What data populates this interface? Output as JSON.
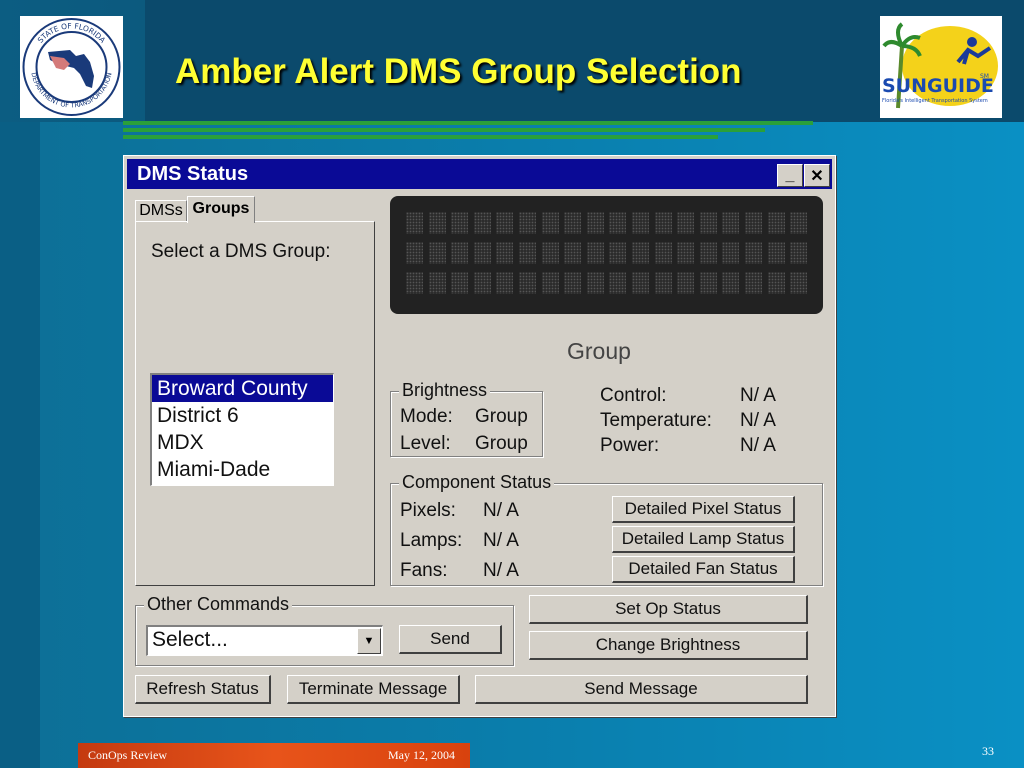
{
  "slide": {
    "title": "Amber Alert DMS Group Selection",
    "footer_left": "ConOps Review",
    "footer_date": "May 12, 2004",
    "page_number": "33",
    "logos": {
      "left": {
        "text_top": "STATE OF FLORIDA",
        "text_bottom": "DEPARTMENT OF TRANSPORTATION"
      },
      "right": {
        "wordmark": "SUNGUIDE",
        "tagline": "Florida's Intelligent Transportation System",
        "mark": "SM"
      }
    }
  },
  "window": {
    "title": "DMS Status",
    "minimize": "_",
    "close": "✕",
    "tabs": [
      {
        "label": "DMSs",
        "active": false
      },
      {
        "label": "Groups",
        "active": true
      }
    ],
    "select_label": "Select a DMS Group:",
    "groups_list": [
      {
        "label": "Broward County",
        "selected": true
      },
      {
        "label": "District 6",
        "selected": false
      },
      {
        "label": "MDX",
        "selected": false
      },
      {
        "label": "Miami-Dade",
        "selected": false
      }
    ],
    "sign_caption": "Group",
    "brightness": {
      "legend": "Brightness",
      "mode_label": "Mode:",
      "mode_value": "Group",
      "level_label": "Level:",
      "level_value": "Group"
    },
    "status": {
      "control_label": "Control:",
      "control_value": "N/ A",
      "temperature_label": "Temperature:",
      "temperature_value": "N/ A",
      "power_label": "Power:",
      "power_value": "N/ A"
    },
    "component_status": {
      "legend": "Component Status",
      "pixels_label": "Pixels:",
      "pixels_value": "N/ A",
      "lamps_label": "Lamps:",
      "lamps_value": "N/ A",
      "fans_label": "Fans:",
      "fans_value": "N/ A",
      "pixel_button": "Detailed Pixel Status",
      "lamp_button": "Detailed Lamp Status",
      "fan_button": "Detailed Fan Status"
    },
    "other_commands": {
      "legend": "Other Commands",
      "select_value": "Select...",
      "send_button": "Send"
    },
    "set_op_status": "Set Op Status",
    "change_brightness": "Change Brightness",
    "refresh_status": "Refresh Status",
    "terminate_message": "Terminate Message",
    "send_message": "Send Message"
  },
  "colors": {
    "title_yellow": "#ffff33",
    "titlebar_blue": "#0a0a96",
    "footer_orange": "#e8541a"
  }
}
